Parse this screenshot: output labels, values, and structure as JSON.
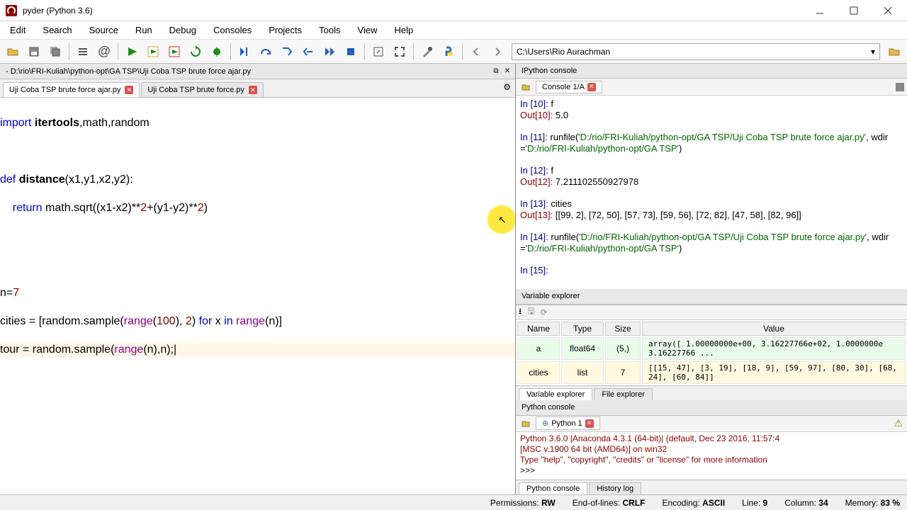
{
  "window": {
    "title": "pyder (Python 3.6)"
  },
  "menu": [
    "Edit",
    "Search",
    "Source",
    "Run",
    "Debug",
    "Consoles",
    "Projects",
    "Tools",
    "View",
    "Help"
  ],
  "path_input": "C:\\Users\\Rio Aurachman",
  "editor": {
    "file_path": "- D:\\rio\\FRI-Kuliah\\python-opt\\GA TSP\\Uji Coba TSP brute force ajar.py",
    "tabs": [
      "Uji Coba TSP brute force ajar.py",
      "Uji Coba TSP brute force.py"
    ]
  },
  "ipython": {
    "pane_title": "IPython console",
    "tab": "Console 1/A",
    "in10": "In [10]: ",
    "in10_code": "f",
    "out10": "Out[10]: ",
    "out10_val": "5.0",
    "in11": "In [11]: ",
    "in11_code": "runfile(",
    "in11_str": "'D:/rio/FRI-Kuliah/python-opt/GA TSP/Uji Coba TSP brute force ajar.py'",
    "in11_mid": ", wdir=",
    "in11_str2": "'D:/rio/FRI-Kuliah/python-opt/GA TSP'",
    "in11_end": ")",
    "in12": "In [12]: ",
    "in12_code": "f",
    "out12": "Out[12]: ",
    "out12_val": "7.211102550927978",
    "in13": "In [13]: ",
    "in13_code": "cities",
    "out13": "Out[13]: ",
    "out13_val": "[[99, 2], [72, 50], [57, 73], [59, 56], [72, 82], [47, 58], [82, 96]]",
    "in14": "In [14]: ",
    "in14_code": "runfile(",
    "in14_str": "'D:/rio/FRI-Kuliah/python-opt/GA TSP/Uji Coba TSP brute force ajar.py'",
    "in14_mid": ", wdir=",
    "in14_str2": "'D:/rio/FRI-Kuliah/python-opt/GA TSP'",
    "in14_end": ")",
    "in15": "In [15]: "
  },
  "varexp": {
    "title": "Variable explorer",
    "headers": [
      "Name",
      "Type",
      "Size",
      "Value"
    ],
    "row_a": {
      "name": "a",
      "type": "float64",
      "size": "(5,)",
      "value": "array([  1.00000000e+00,   3.16227766e+02,   1.0000000e\n        3.16227766 ..."
    },
    "row_cities": {
      "name": "cities",
      "type": "list",
      "size": "7",
      "value": "[[15, 47], [3, 19], [18, 9], [59, 97], [80, 30], [68, 24], [60, 84]]"
    },
    "tabs": [
      "Variable explorer",
      "File explorer"
    ]
  },
  "pyconsole": {
    "title": "Python console",
    "tab": "Python 1",
    "line1": "Python 3.6.0 |Anaconda 4.3.1 (64-bit)| (default, Dec 23 2016, 11:57:4",
    "line2": "[MSC v.1900 64 bit (AMD64)] on win32",
    "line3": "Type \"help\", \"copyright\", \"credits\" or \"license\" for more information",
    "prompt": ">>> ",
    "tabs": [
      "Python console",
      "History log"
    ]
  },
  "status": {
    "perm": "Permissions:",
    "perm_v": "RW",
    "eol": "End-of-lines:",
    "eol_v": "CRLF",
    "enc": "Encoding:",
    "enc_v": "ASCII",
    "line": "Line:",
    "line_v": "9",
    "col": "Column:",
    "col_v": "34",
    "mem": "Memory:",
    "mem_v": "83 %"
  }
}
